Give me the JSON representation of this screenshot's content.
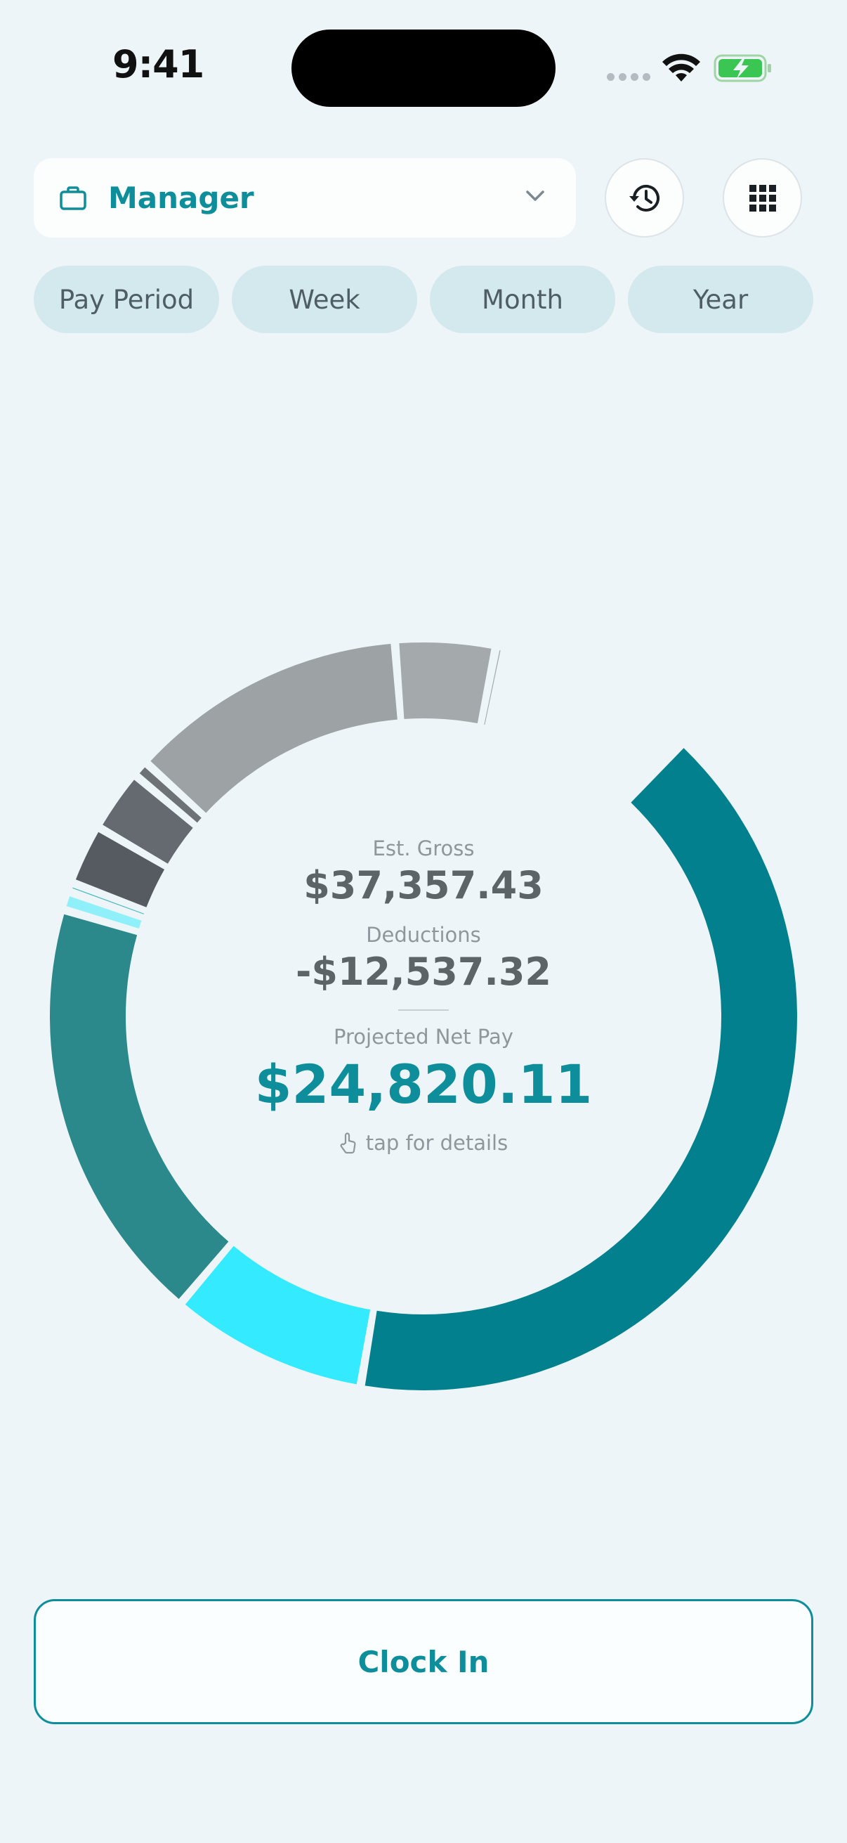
{
  "status_bar": {
    "time": "9:41"
  },
  "job_selector": {
    "label": "Manager",
    "icon": "briefcase-icon"
  },
  "toolbar": {
    "history_icon": "history-icon",
    "grid_icon": "grid-icon"
  },
  "period_tabs": [
    {
      "label": "Pay Period",
      "active": false
    },
    {
      "label": "Week",
      "active": false
    },
    {
      "label": "Month",
      "active": false
    },
    {
      "label": "Year",
      "active": true
    }
  ],
  "summary": {
    "gross_label": "Est. Gross",
    "gross_value": "$37,357.43",
    "deductions_label": "Deductions",
    "deductions_value": "-$12,537.32",
    "net_label": "Projected Net Pay",
    "net_value": "$24,820.11",
    "hint": "tap for details"
  },
  "chart_data": {
    "type": "pie",
    "variant": "donut",
    "segments": [
      {
        "fraction": 0.406,
        "color": "#03808E"
      },
      {
        "fraction": 0.085,
        "color": "#33EAFF"
      },
      {
        "fraction": 0.184,
        "color": "#2B898C"
      },
      {
        "fraction": 0.008,
        "color": "#8FF0FA"
      },
      {
        "fraction": 0.004,
        "color": "#45B9C2"
      },
      {
        "fraction": 0.026,
        "color": "#555B61"
      },
      {
        "fraction": 0.027,
        "color": "#646A70"
      },
      {
        "fraction": 0.007,
        "color": "#6C7276"
      },
      {
        "fraction": 0.12,
        "color": "#9DA3A5"
      },
      {
        "fraction": 0.043,
        "color": "#A4A9AB"
      },
      {
        "fraction": 0.004,
        "color": "#A4AAAC"
      }
    ]
  },
  "actions": {
    "clock_in_label": "Clock In"
  },
  "colors": {
    "accent": "#0E8E9B",
    "background": "#EEF5F8",
    "tab_inactive": "#D3E9EE"
  }
}
